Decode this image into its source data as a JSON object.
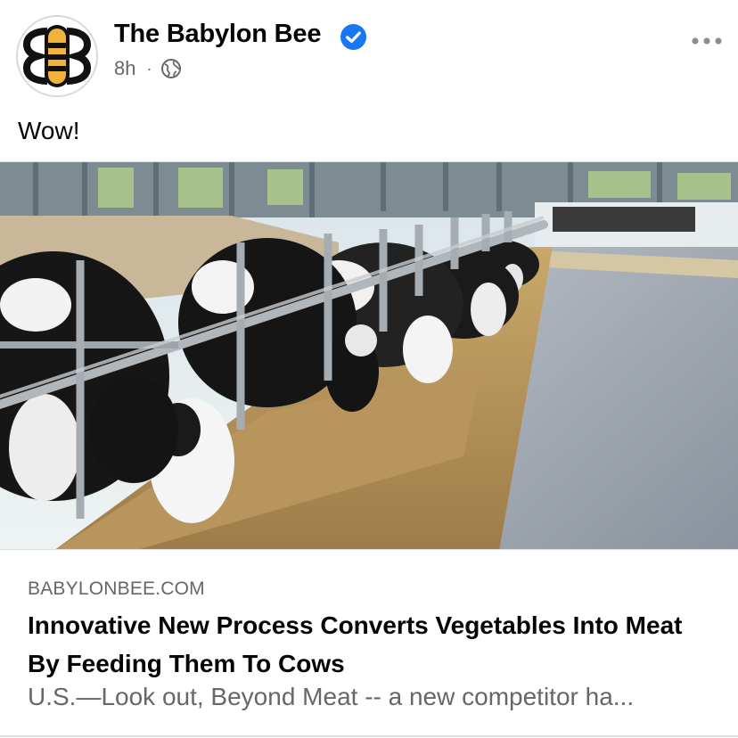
{
  "post": {
    "author": "The Babylon Bee",
    "verified": true,
    "time": "8h",
    "separator": "·",
    "audience_icon": "globe-icon",
    "more_icon": "more-dots-icon",
    "text": "Wow!"
  },
  "link_card": {
    "domain": "BABYLONBEE.COM",
    "title": "Innovative New Process Converts Vegetables Into Meat By Feeding Them To Cows",
    "description": "U.S.—Look out, Beyond Meat -- a new competitor ha..."
  },
  "colors": {
    "verified_blue": "#1877f2",
    "secondary_text": "#65676b",
    "primary_text": "#050505",
    "bee_yellow": "#f2b33d"
  }
}
